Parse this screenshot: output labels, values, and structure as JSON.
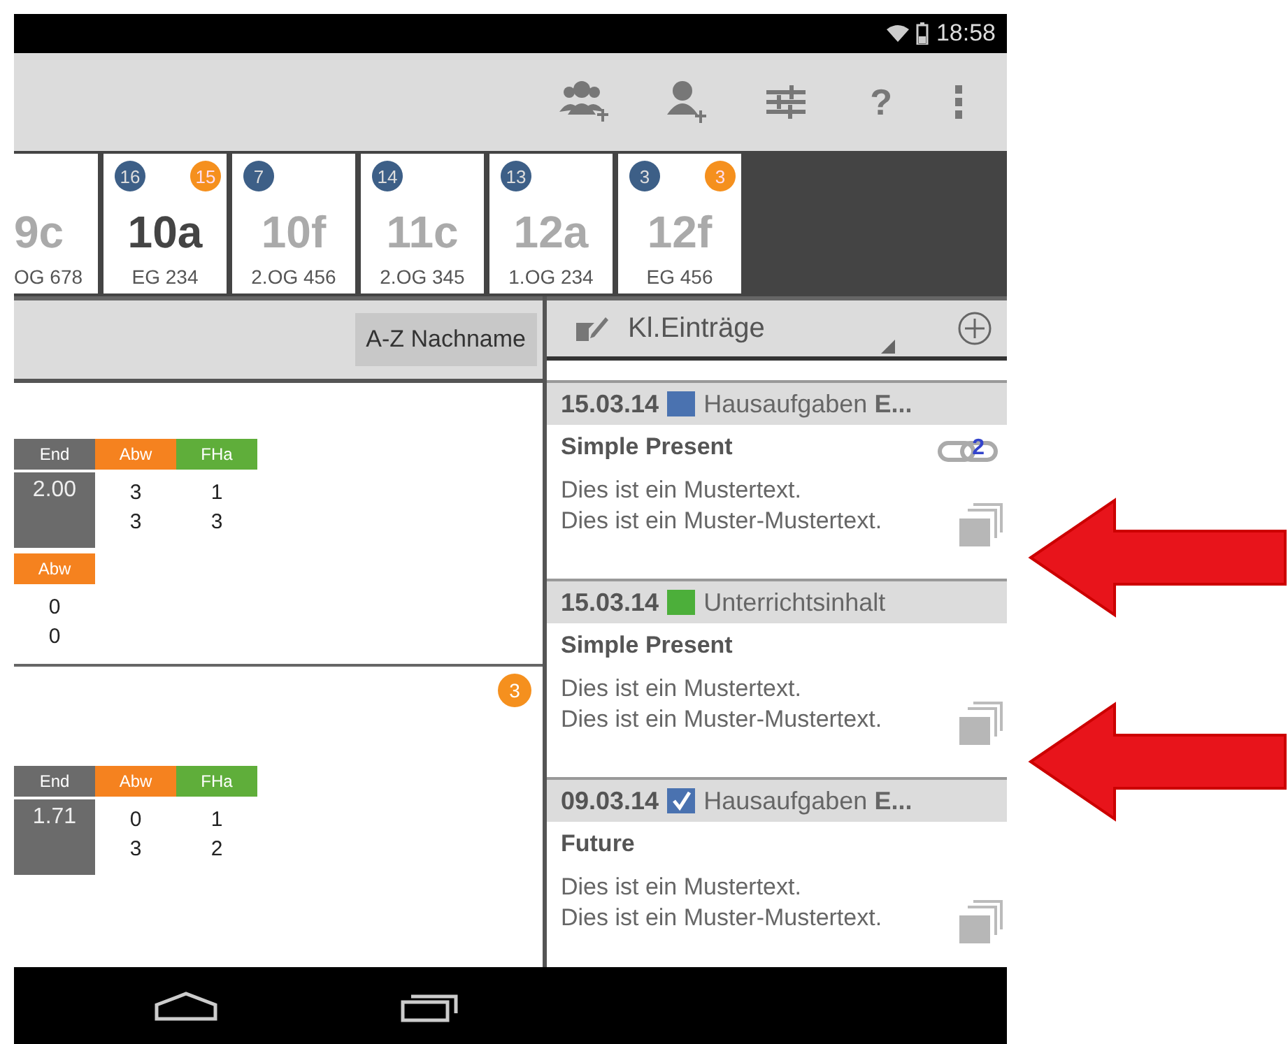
{
  "status_bar": {
    "time": "18:58"
  },
  "action_bar": {
    "help": "?"
  },
  "classes": [
    {
      "name": "9c",
      "room": "OG 678",
      "selected": false
    },
    {
      "name": "10a",
      "room": "EG 234",
      "count": "16",
      "alert": "15",
      "selected": true
    },
    {
      "name": "10f",
      "room": "2.OG 456",
      "count": "7",
      "selected": false
    },
    {
      "name": "11c",
      "room": "2.OG 345",
      "count": "14",
      "selected": false
    },
    {
      "name": "12a",
      "room": "1.OG 234",
      "count": "13",
      "selected": false
    },
    {
      "name": "12f",
      "room": "EG 456",
      "count": "3",
      "alert": "3",
      "selected": false
    }
  ],
  "sort_button": "A-Z Nachname",
  "students": [
    {
      "groups": [
        [
          {
            "kind": "end",
            "label": "End",
            "values": [
              "2.00"
            ]
          },
          {
            "kind": "abw",
            "label": "Abw",
            "values": [
              "3",
              "3"
            ]
          },
          {
            "kind": "fha",
            "label": "FHa",
            "values": [
              "1",
              "3"
            ]
          }
        ],
        [
          {
            "kind": "abw",
            "label": "Abw",
            "values": [
              "0",
              "0"
            ]
          }
        ]
      ]
    },
    {
      "badge": "3",
      "groups": [
        [
          {
            "kind": "end",
            "label": "End",
            "values": [
              "1.71"
            ]
          },
          {
            "kind": "abw",
            "label": "Abw",
            "values": [
              "0",
              "3"
            ]
          },
          {
            "kind": "fha",
            "label": "FHa",
            "values": [
              "1",
              "2"
            ]
          }
        ]
      ]
    }
  ],
  "entries_panel": {
    "filter": "Kl.Einträge",
    "entries": [
      {
        "date": "15.03.14",
        "kind": "square",
        "color": "#4a72b0",
        "category": "Hausaufgaben **E...**",
        "title": "Simple Present",
        "links": "2",
        "lines": [
          "Dies ist ein Mustertext.",
          "Dies ist ein Muster-Mustertext."
        ]
      },
      {
        "date": "15.03.14",
        "kind": "square",
        "color": "#4caf3a",
        "category": "Unterrichtsinhalt",
        "title": "Simple Present",
        "lines": [
          "Dies ist ein Mustertext.",
          "Dies ist ein Muster-Mustertext."
        ]
      },
      {
        "date": "09.03.14",
        "kind": "check",
        "color": "#4a72b0",
        "category": "Hausaufgaben **E...**",
        "title": "Future",
        "lines": [
          "Dies ist ein Mustertext.",
          "Dies ist ein Muster-Mustertext."
        ]
      }
    ]
  }
}
